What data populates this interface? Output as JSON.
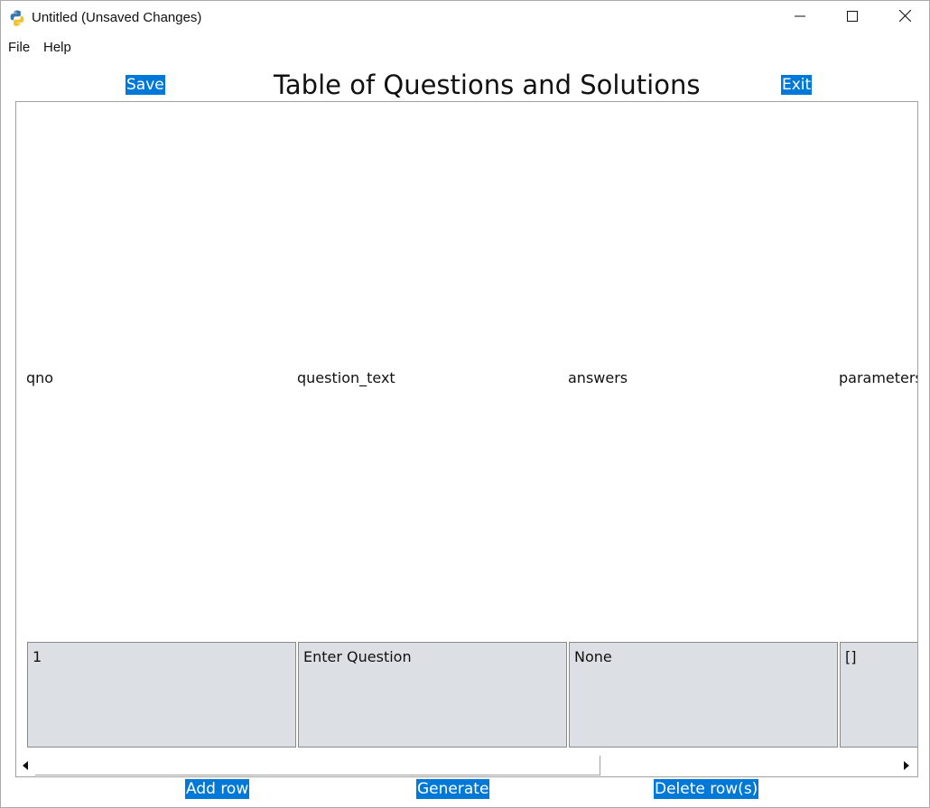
{
  "window": {
    "title": "Untitled (Unsaved Changes)",
    "icons": {
      "app": "python-icon",
      "minimize": "minimize-icon",
      "maximize": "maximize-icon",
      "close": "close-icon"
    }
  },
  "menu": {
    "items": [
      {
        "label": "File"
      },
      {
        "label": "Help"
      }
    ]
  },
  "toolbar": {
    "save_label": "Save",
    "exit_label": "Exit"
  },
  "page": {
    "title": "Table of Questions and Solutions"
  },
  "table": {
    "columns": [
      "qno",
      "question_text",
      "answers",
      "parameters"
    ],
    "rows": [
      [
        "1",
        "Enter Question",
        "None",
        "[]"
      ]
    ],
    "cell_color": "#dcdfe3"
  },
  "footer": {
    "add_row_label": "Add row",
    "generate_label": "Generate",
    "delete_label": "Delete row(s)"
  },
  "colors": {
    "button_bg": "#0078d7",
    "button_fg": "#ffffff"
  }
}
